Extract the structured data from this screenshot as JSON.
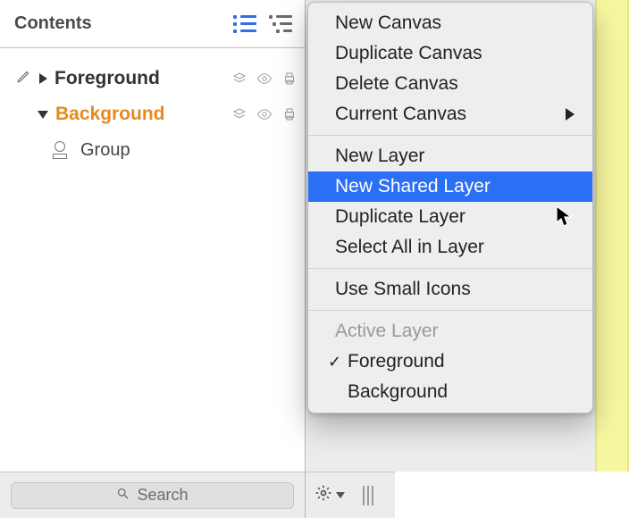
{
  "sidebar": {
    "title": "Contents",
    "layers": [
      {
        "name": "Foreground",
        "selected": false,
        "expanded": false
      },
      {
        "name": "Background",
        "selected": true,
        "expanded": true
      }
    ],
    "group_label": "Group",
    "search_placeholder": "Search"
  },
  "menu": {
    "sections": [
      [
        {
          "label": "New Canvas"
        },
        {
          "label": "Duplicate Canvas"
        },
        {
          "label": "Delete Canvas"
        },
        {
          "label": "Current Canvas",
          "submenu": true
        }
      ],
      [
        {
          "label": "New Layer"
        },
        {
          "label": "New Shared Layer",
          "highlight": true
        },
        {
          "label": "Duplicate Layer"
        },
        {
          "label": "Select All in Layer"
        }
      ],
      [
        {
          "label": "Use Small Icons"
        }
      ],
      [
        {
          "label": "Active Layer",
          "disabled": true
        },
        {
          "label": "Foreground",
          "indent": true,
          "checked": true
        },
        {
          "label": "Background",
          "indent": true
        }
      ]
    ]
  }
}
